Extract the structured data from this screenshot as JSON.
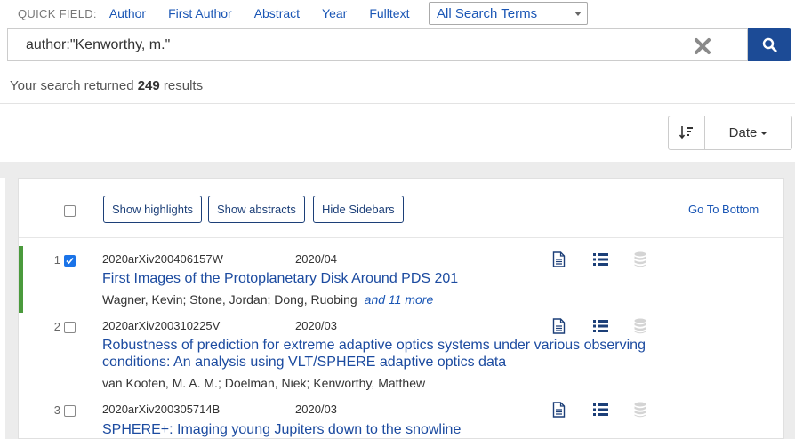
{
  "quick_field": {
    "label": "QUICK FIELD:",
    "links": [
      "Author",
      "First Author",
      "Abstract",
      "Year",
      "Fulltext"
    ],
    "select_value": "All Search Terms"
  },
  "search": {
    "query": "author:\"Kenworthy, m.\""
  },
  "results_summary": {
    "prefix": "Your search returned",
    "count": "249",
    "suffix": "results"
  },
  "sort": {
    "field": "Date"
  },
  "toolbar": {
    "show_highlights": "Show highlights",
    "show_abstracts": "Show abstracts",
    "hide_sidebars": "Hide Sidebars",
    "go_to_bottom": "Go To Bottom"
  },
  "colors": {
    "accent": "#1c4b96",
    "link": "#1a56b5",
    "selected_bar": "#4a9a3c"
  },
  "results": [
    {
      "index": "1",
      "checked": true,
      "bibcode": "2020arXiv200406157W",
      "date": "2020/04",
      "title": "First Images of the Protoplanetary Disk Around PDS 201",
      "authors": "Wagner, Kevin;  Stone, Jordan;  Dong, Ruobing",
      "more": "and 11 more",
      "icons": [
        "document-icon",
        "list-icon",
        "database-icon"
      ]
    },
    {
      "index": "2",
      "checked": false,
      "bibcode": "2020arXiv200310225V",
      "date": "2020/03",
      "title_line1": "Robustness of prediction for extreme adaptive optics systems under various observing",
      "title_line2": "conditions: An analysis using VLT/SPHERE adaptive optics data",
      "authors": "van Kooten, M. A. M.;  Doelman, Niek;  Kenworthy, Matthew",
      "icons": [
        "document-icon",
        "list-icon",
        "database-icon"
      ]
    },
    {
      "index": "3",
      "checked": false,
      "bibcode": "2020arXiv200305714B",
      "date": "2020/03",
      "title": "SPHERE+: Imaging young Jupiters down to the snowline",
      "icons": [
        "document-icon",
        "list-icon",
        "database-icon"
      ]
    }
  ]
}
